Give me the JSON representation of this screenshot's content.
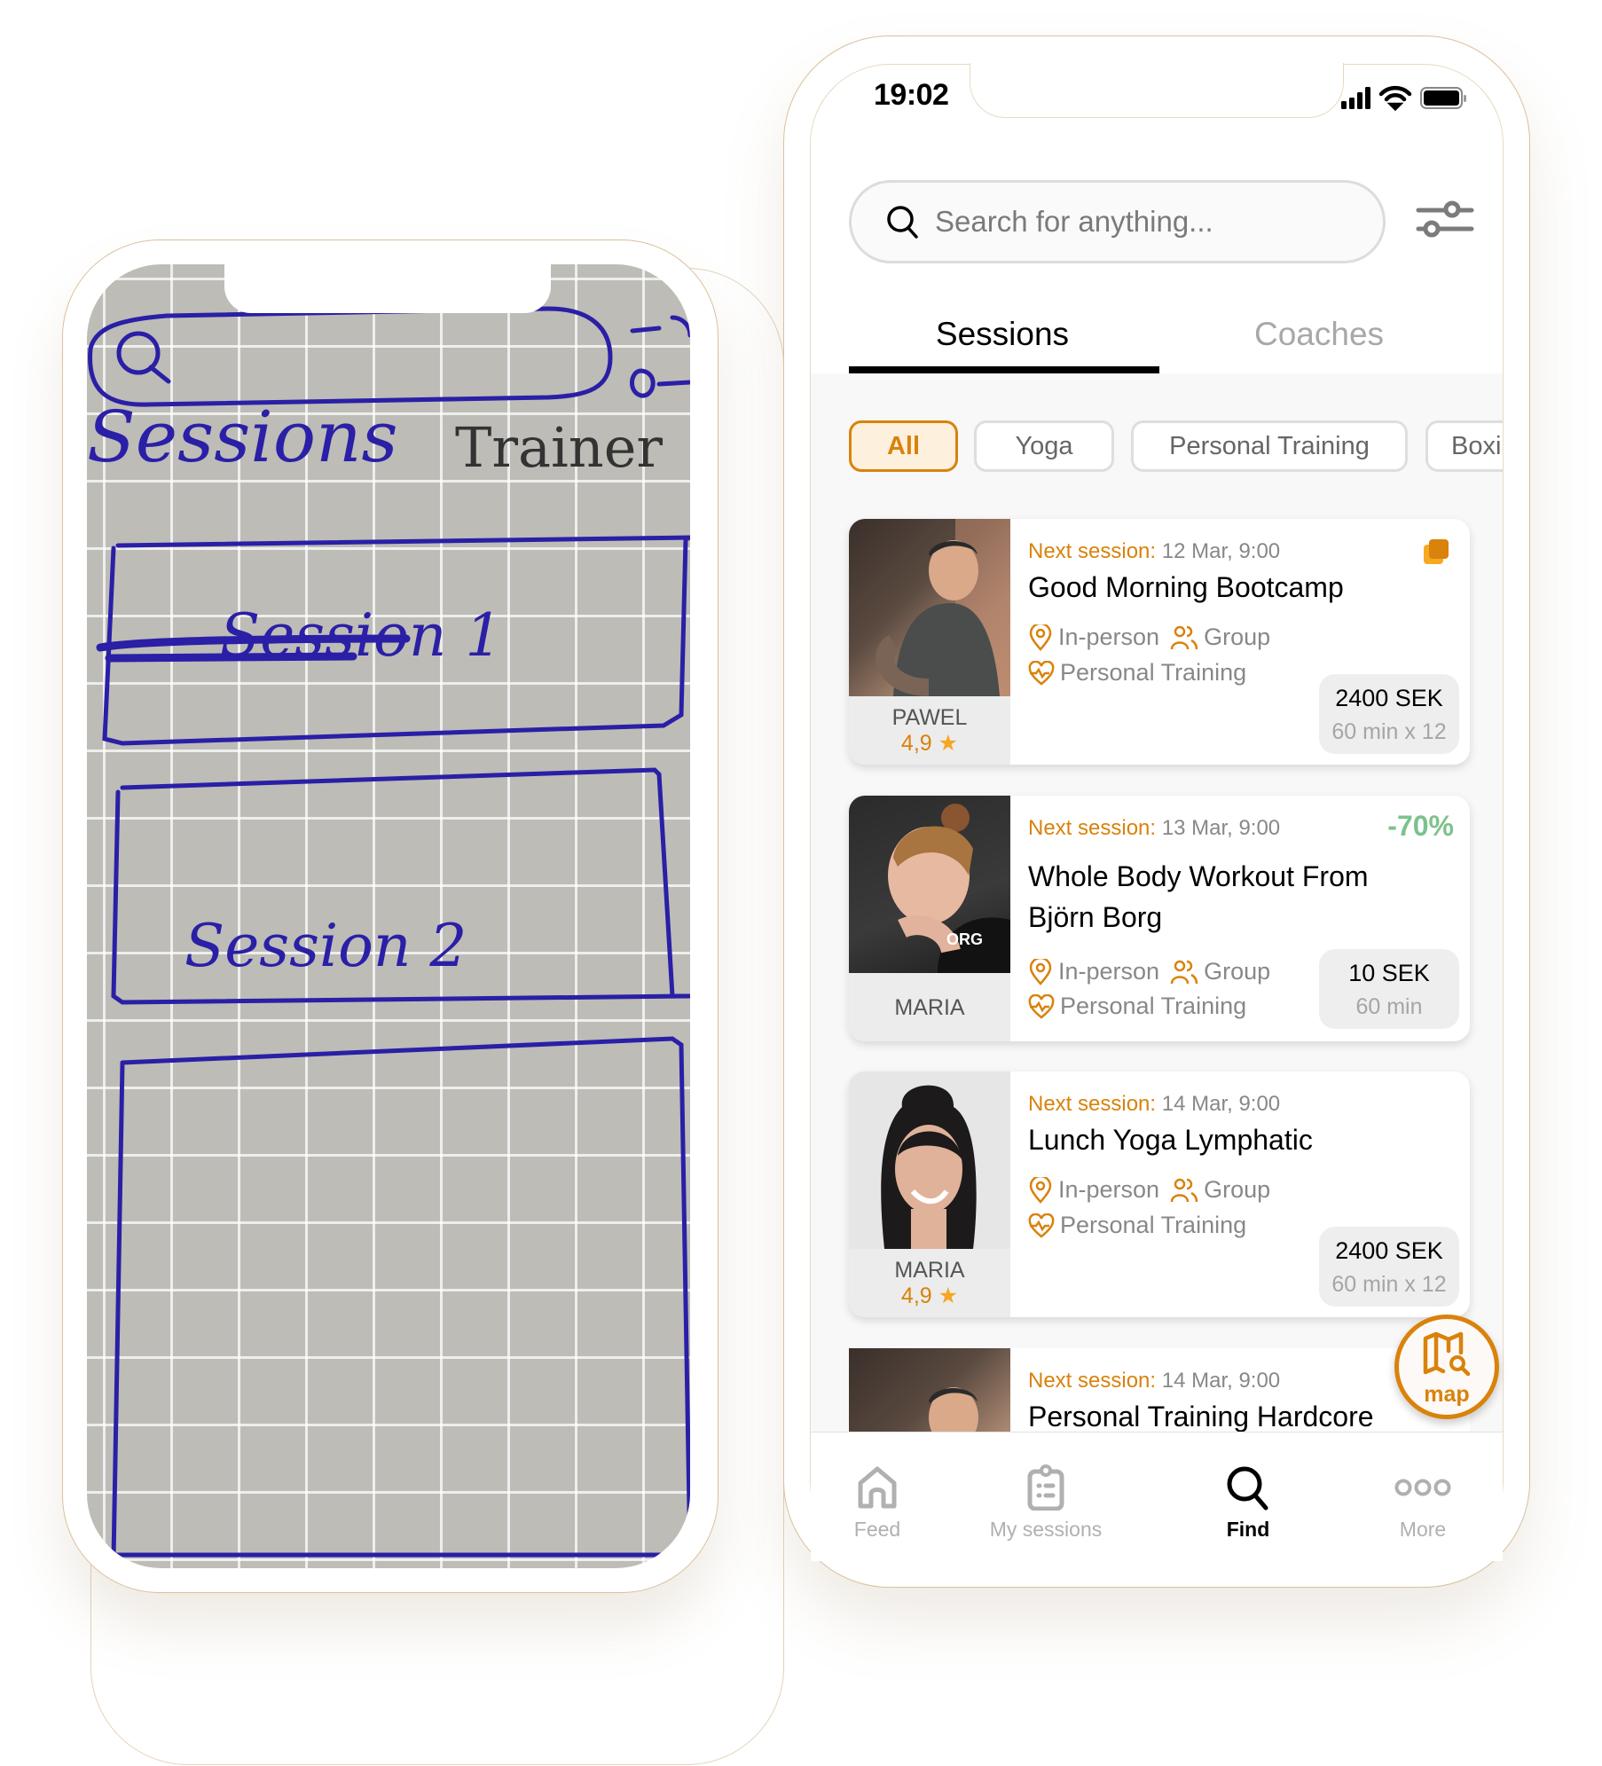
{
  "sketch_phone": {
    "tabs": [
      "Sessions",
      "Trainer"
    ],
    "boxes": [
      "Session 1",
      "Session 2",
      ""
    ]
  },
  "app_phone": {
    "status_bar": {
      "time": "19:02",
      "icons": [
        "signal-icon",
        "wifi-icon",
        "battery-icon"
      ]
    },
    "search": {
      "placeholder": "Search for anything...",
      "value": ""
    },
    "tabs": [
      {
        "label": "Sessions",
        "active": true
      },
      {
        "label": "Coaches",
        "active": false
      }
    ],
    "filters": [
      {
        "label": "All",
        "active": true
      },
      {
        "label": "Yoga",
        "active": false
      },
      {
        "label": "Personal Training",
        "active": false
      },
      {
        "label": "Boxi",
        "active": false
      }
    ],
    "cards": [
      {
        "next_label": "Next session:",
        "next_value": "12 Mar, 9:00",
        "title": "Good Morning Bootcamp",
        "mode": "In-person",
        "group": "Group",
        "category": "Personal Training",
        "coach": "PAWEL",
        "rating": "4,9",
        "price": "2400 SEK",
        "duration": "60 min x 12",
        "badge": "stack-icon",
        "discount": ""
      },
      {
        "next_label": "Next session:",
        "next_value": "13 Mar, 9:00",
        "title": "Whole Body Workout From Björn Borg",
        "mode": "In-person",
        "group": "Group",
        "category": "Personal Training",
        "coach": "MARIA",
        "rating": "",
        "price": "10 SEK",
        "duration": "60 min",
        "discount": "-70%"
      },
      {
        "next_label": "Next session:",
        "next_value": "14 Mar, 9:00",
        "title": "Lunch Yoga Lymphatic",
        "mode": "In-person",
        "group": "Group",
        "category": "Personal Training",
        "coach": "MARIA",
        "rating": "4,9",
        "price": "2400 SEK",
        "duration": "60 min x 12",
        "discount": ""
      },
      {
        "next_label": "Next session:",
        "next_value": "14 Mar, 9:00",
        "title": "Personal Training Hardcore"
      }
    ],
    "map_button": {
      "label": "map"
    },
    "tabbar": [
      {
        "label": "Feed",
        "icon": "home-icon",
        "active": false
      },
      {
        "label": "My sessions",
        "icon": "clipboard-icon",
        "active": false
      },
      {
        "label": "Find",
        "icon": "search-icon",
        "active": true
      },
      {
        "label": "More",
        "icon": "more-icon",
        "active": false
      }
    ],
    "colors": {
      "accent": "#d9820c",
      "accent_light": "#fdf0dd",
      "discount": "#7cc28c",
      "sketch_ink": "#2a1fa6"
    }
  }
}
